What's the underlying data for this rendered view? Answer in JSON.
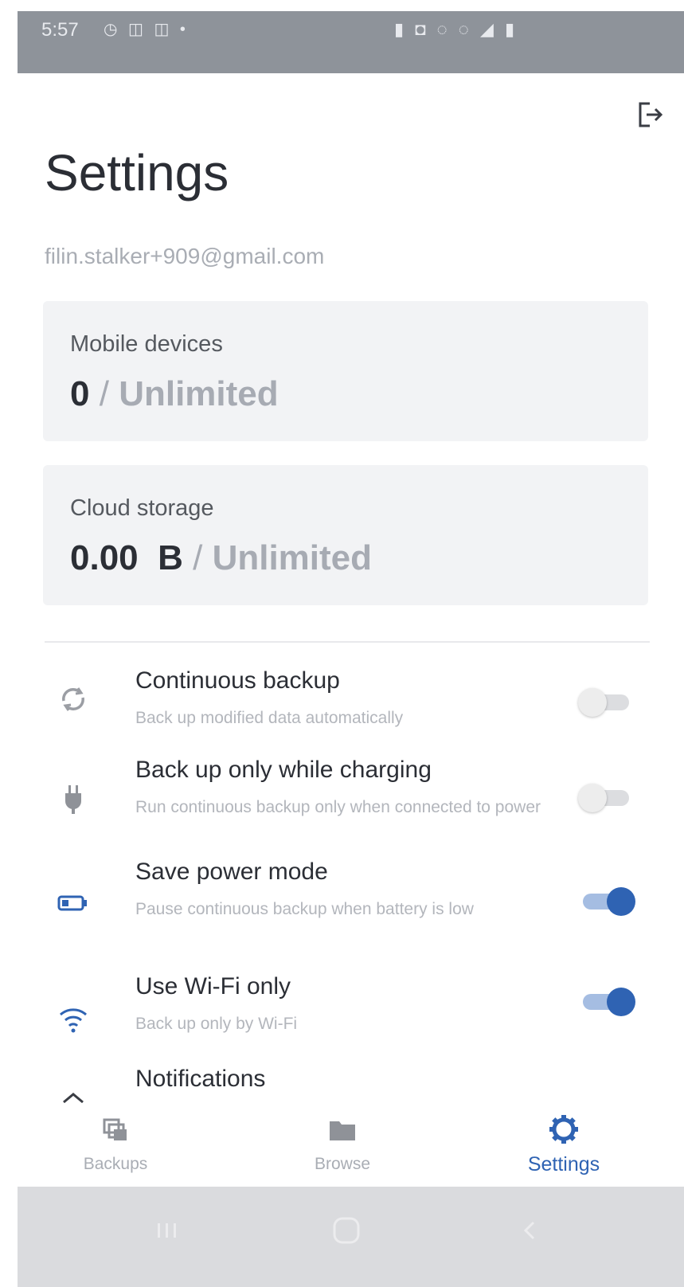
{
  "status_bar": {
    "time": "5:57",
    "left_icons": "◷ ◫ ◫ •",
    "right_icons": "▮ ◘ ◌ ◌ ◢ ▮"
  },
  "header": {
    "logout_icon": "logout-icon",
    "title": "Settings",
    "email": "filin.stalker+909@gmail.com"
  },
  "cards": {
    "mobile": {
      "label": "Mobile devices",
      "used": "0",
      "separator": "/",
      "limit": "Unlimited"
    },
    "storage": {
      "label": "Cloud storage",
      "used": "0.00  B",
      "separator": "/",
      "limit": "Unlimited"
    }
  },
  "settings": [
    {
      "icon": "sync-icon",
      "title": "Continuous backup",
      "desc": "Back up modified data automatically",
      "enabled": false
    },
    {
      "icon": "plug-icon",
      "title": "Back up only while charging",
      "desc": "Run continuous backup only when connected to power",
      "enabled": false
    },
    {
      "icon": "battery-icon",
      "title": "Save power mode",
      "desc": "Pause continuous backup when battery is low",
      "enabled": true
    },
    {
      "icon": "wifi-icon",
      "title": "Use Wi-Fi only",
      "desc": "Back up only by Wi-Fi",
      "enabled": true
    },
    {
      "icon": "chevron-up-icon",
      "title": "Notifications"
    }
  ],
  "bottom_nav": [
    {
      "label": "Backups",
      "icon": "backups-icon",
      "active": false
    },
    {
      "label": "Browse",
      "icon": "folder-icon",
      "active": false
    },
    {
      "label": "Settings",
      "icon": "gear-icon",
      "active": true
    }
  ],
  "colors": {
    "accent": "#2f63b3",
    "status_bar": "#8e939a",
    "card_bg": "#f2f3f5",
    "muted_text": "#a9adb4"
  }
}
